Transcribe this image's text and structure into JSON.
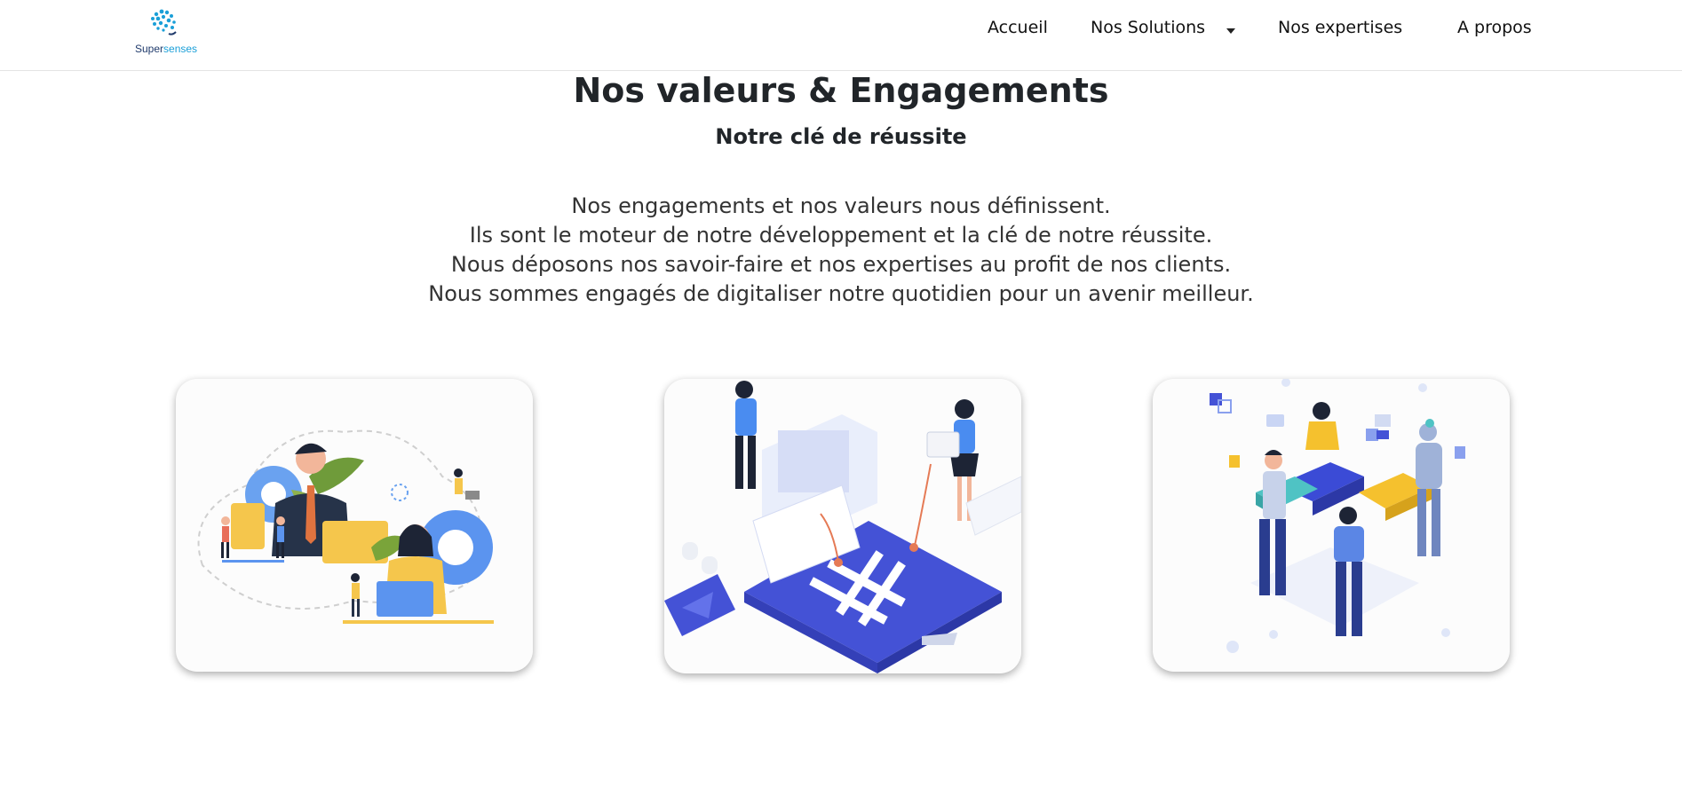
{
  "brand": {
    "name_part1": "Super",
    "name_part2": "senses"
  },
  "nav": {
    "items": [
      {
        "label": "Accueil"
      },
      {
        "label": "Nos Solutions"
      },
      {
        "label": "Nos expertises"
      },
      {
        "label": "A propos"
      }
    ]
  },
  "main": {
    "title": "Nos valeurs & Engagements",
    "subtitle": "Notre clé de réussite",
    "paragraph": [
      "Nos engagements et nos valeurs nous définissent.",
      "Ils sont le moteur de notre développement et la clé de notre réussite.",
      "Nous déposons nos savoir-faire et nos expertises au profit de nos clients.",
      "Nous sommes engagés de digitaliser notre quotidien pour un avenir meilleur."
    ]
  },
  "colors": {
    "accent_blue": "#4a5be0",
    "brand_blue": "#1a9fd8",
    "brand_navy": "#1f3a6b",
    "yellow": "#f7c843"
  }
}
